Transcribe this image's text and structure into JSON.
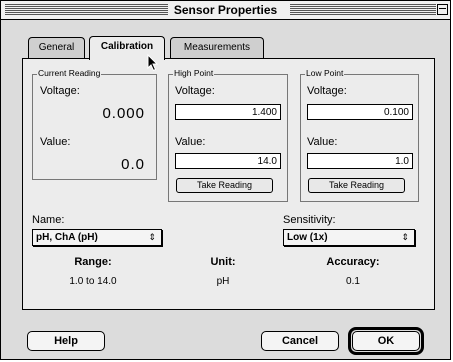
{
  "window": {
    "title": "Sensor Properties"
  },
  "tabs": [
    {
      "label": "General",
      "active": false
    },
    {
      "label": "Calibration",
      "active": true
    },
    {
      "label": "Measurements",
      "active": false
    }
  ],
  "current_reading": {
    "title": "Current Reading",
    "voltage_label": "Voltage:",
    "voltage_value": "0.000",
    "value_label": "Value:",
    "value_value": "0.0"
  },
  "high_point": {
    "title": "High Point",
    "voltage_label": "Voltage:",
    "voltage_value": "1.400",
    "value_label": "Value:",
    "value_value": "14.0",
    "button": "Take Reading"
  },
  "low_point": {
    "title": "Low Point",
    "voltage_label": "Voltage:",
    "voltage_value": "0.100",
    "value_label": "Value:",
    "value_value": "1.0",
    "button": "Take Reading"
  },
  "name": {
    "label": "Name:",
    "selected": "pH, ChA (pH)"
  },
  "sensitivity": {
    "label": "Sensitivity:",
    "selected": "Low (1x)"
  },
  "range": {
    "label": "Range:",
    "value": "1.0 to 14.0"
  },
  "unit": {
    "label": "Unit:",
    "value": "pH"
  },
  "accuracy": {
    "label": "Accuracy:",
    "value": "0.1"
  },
  "buttons": {
    "help": "Help",
    "cancel": "Cancel",
    "ok": "OK"
  },
  "icons": {
    "popup_arrows": "up-down-arrows-icon",
    "cursor": "arrow-cursor-icon"
  }
}
